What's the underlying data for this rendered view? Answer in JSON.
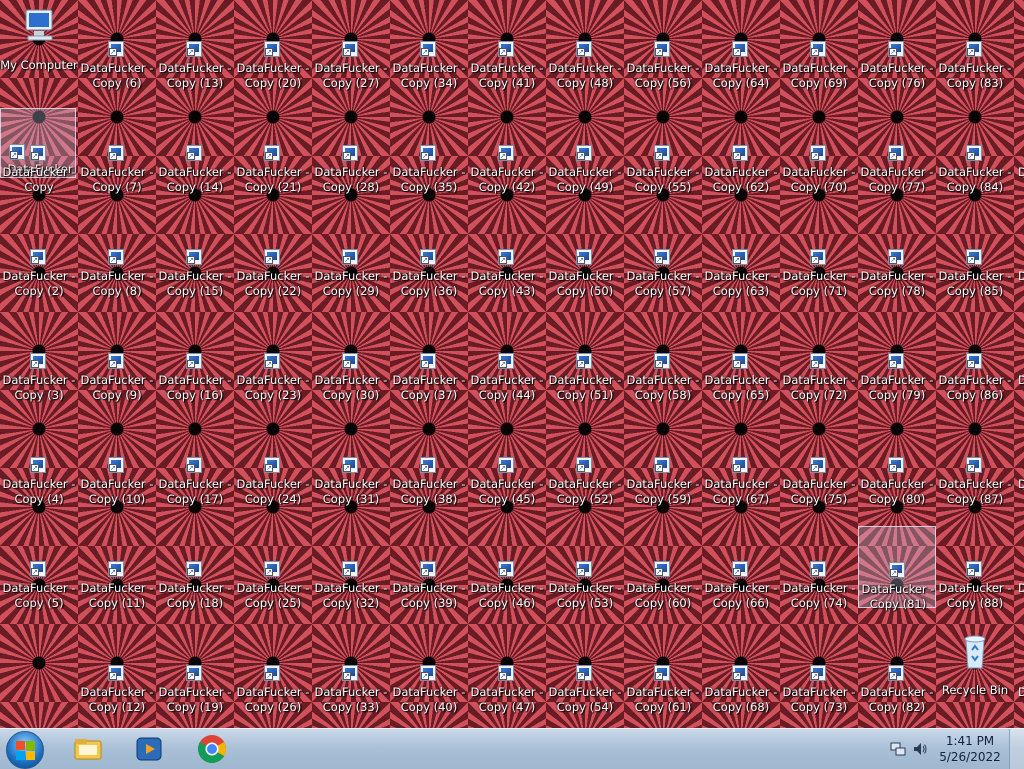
{
  "desktop": {
    "my_computer_label": "My Computer",
    "recycle_bin_label": "Recycle Bin",
    "shortcut_title": "DataFucker -",
    "selected_first_label": "DataFucker",
    "columns": [
      [
        "",
        "Copy",
        "Copy (2)",
        "Copy (3)",
        "Copy (4)",
        "Copy (5)"
      ],
      [
        "Copy (6)",
        "Copy (7)",
        "Copy (8)",
        "Copy (9)",
        "Copy (10)",
        "Copy (11)",
        "Copy (12)"
      ],
      [
        "Copy (13)",
        "Copy (14)",
        "Copy (15)",
        "Copy (16)",
        "Copy (17)",
        "Copy (18)",
        "Copy (19)"
      ],
      [
        "Copy (20)",
        "Copy (21)",
        "Copy (22)",
        "Copy (23)",
        "Copy (24)",
        "Copy (25)",
        "Copy (26)"
      ],
      [
        "Copy (27)",
        "Copy (28)",
        "Copy (29)",
        "Copy (30)",
        "Copy (31)",
        "Copy (32)",
        "Copy (33)"
      ],
      [
        "Copy (34)",
        "Copy (35)",
        "Copy (36)",
        "Copy (37)",
        "Copy (38)",
        "Copy (39)",
        "Copy (40)"
      ],
      [
        "Copy (41)",
        "Copy (42)",
        "Copy (43)",
        "Copy (44)",
        "Copy (45)",
        "Copy (46)",
        "Copy (47)"
      ],
      [
        "Copy (48)",
        "Copy (49)",
        "Copy (50)",
        "Copy (51)",
        "Copy (52)",
        "Copy (53)",
        "Copy (54)"
      ],
      [
        "Copy (56)",
        "Copy (55)",
        "Copy (57)",
        "Copy (58)",
        "Copy (59)",
        "Copy (60)",
        "Copy (61)"
      ],
      [
        "Copy (64)",
        "Copy (62)",
        "Copy (63)",
        "Copy (65)",
        "Copy (67)",
        "Copy (66)",
        "Copy (68)"
      ],
      [
        "Copy (69)",
        "Copy (70)",
        "Copy (71)",
        "Copy (72)",
        "Copy (75)",
        "Copy (74)",
        "Copy (73)"
      ],
      [
        "Copy (76)",
        "Copy (77)",
        "Copy (78)",
        "Copy (79)",
        "Copy (80)",
        "Copy (81)",
        "Copy (82)"
      ],
      [
        "Copy (83)",
        "Copy (84)",
        "Copy (85)",
        "Copy (86)",
        "Copy (87)",
        "Copy (88)"
      ]
    ],
    "edge_fragment": "D",
    "selected_items": [
      "DataFucker",
      "DataFucker - Copy (81)"
    ]
  },
  "taskbar": {
    "clock_time": "1:41 PM",
    "clock_date": "5/26/2022",
    "pinned": [
      "windows-explorer-icon",
      "media-player-icon",
      "chrome-icon"
    ],
    "tray_icons": [
      "network-icon",
      "volume-icon"
    ]
  }
}
